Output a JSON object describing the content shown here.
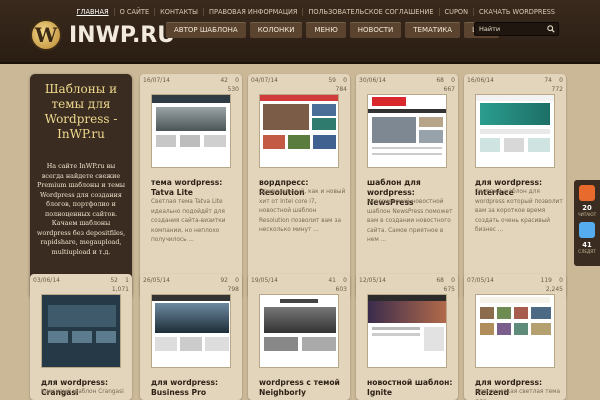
{
  "header": {
    "logo_text": "INWP.RU",
    "logo_letter": "W",
    "top_links": [
      "ГЛАВНАЯ",
      "О САЙТЕ",
      "КОНТАКТЫ",
      "ПРАВОВАЯ ИНФОРМАЦИЯ",
      "ПОЛЬЗОВАТЕЛЬСКОЕ СОГЛАШЕНИЕ",
      "CUPON",
      "СКАЧАТЬ WORDPRESS"
    ],
    "main_tabs": [
      "АВТОР ШАБЛОНА",
      "КОЛОНКИ",
      "МЕНЮ",
      "НОВОСТИ",
      "ТЕМАТИКА",
      "ЦВЕТ"
    ],
    "search_placeholder": "Найти"
  },
  "promo": {
    "title": "Шаблоны и темы для Wordpress - InWP.ru",
    "text": "На сайте InWP.ru вы всегда найдете свежие Premium шаблоны и темы Wordpress для создания блогов, портфолио и полноценных сайтов. Качаем шаблоны wordpress без depositfiles, rapidshare, megaupload, multiupload и т.д."
  },
  "cards": [
    {
      "date": "16/07/14",
      "views": "42",
      "comments": "0",
      "downloads": "530",
      "title": "тема wordpress: Tatva Lite",
      "desc": "Светлая тема Tatva Lite идеально подойдёт для создания сайта-визитки компании, но неплохо получилось ..."
    },
    {
      "date": "04/07/14",
      "views": "59",
      "comments": "0",
      "downloads": "784",
      "title": "вордпресс: Resolution",
      "desc": "Оригинальный, как и новый хит от Intel core i7, новостной шаблон Resolution позволит вам за несколько минут ..."
    },
    {
      "date": "30/06/14",
      "views": "68",
      "comments": "0",
      "downloads": "667",
      "title": "шаблон для wordpress: NewsPress",
      "desc": "Классический новостной шаблон NewsPress поможет вам в создании новостного сайта. Самое приятное в нем ..."
    },
    {
      "date": "16/06/14",
      "views": "74",
      "comments": "0",
      "downloads": "772",
      "title": "для wordpress: Interface",
      "desc": "Светлый шаблон для wordpress который позволит вам за короткое время создать очень красивый бизнес ..."
    },
    {
      "date": "03/06/14",
      "views": "52",
      "comments": "1",
      "downloads": "1,071",
      "title": "для wordpress: Crangasi",
      "desc": "Красивый шаблон Crangasi"
    },
    {
      "date": "26/05/14",
      "views": "92",
      "comments": "0",
      "downloads": "798",
      "title": "для wordpress: Business Pro",
      "desc": ""
    },
    {
      "date": "19/05/14",
      "views": "41",
      "comments": "0",
      "downloads": "603",
      "title": "wordpress с темой Neighborly",
      "desc": ""
    },
    {
      "date": "12/05/14",
      "views": "68",
      "comments": "0",
      "downloads": "675",
      "title": "новостной шаблон: Ignite",
      "desc": ""
    },
    {
      "date": "07/05/14",
      "views": "119",
      "comments": "0",
      "downloads": "2,245",
      "title": "для wordpress: Reizend",
      "desc": "Классическая светлая тема для"
    }
  ],
  "share": {
    "count1": "20",
    "label1": "ЧИТАЮТ",
    "count2": "41",
    "label2": "СЛЕДЯТ"
  },
  "colors": {
    "header_bg": "#2a1d13",
    "page_bg": "#cbb897",
    "card_bg": "#e3d5bb",
    "accent_gold": "#f0d98f"
  }
}
